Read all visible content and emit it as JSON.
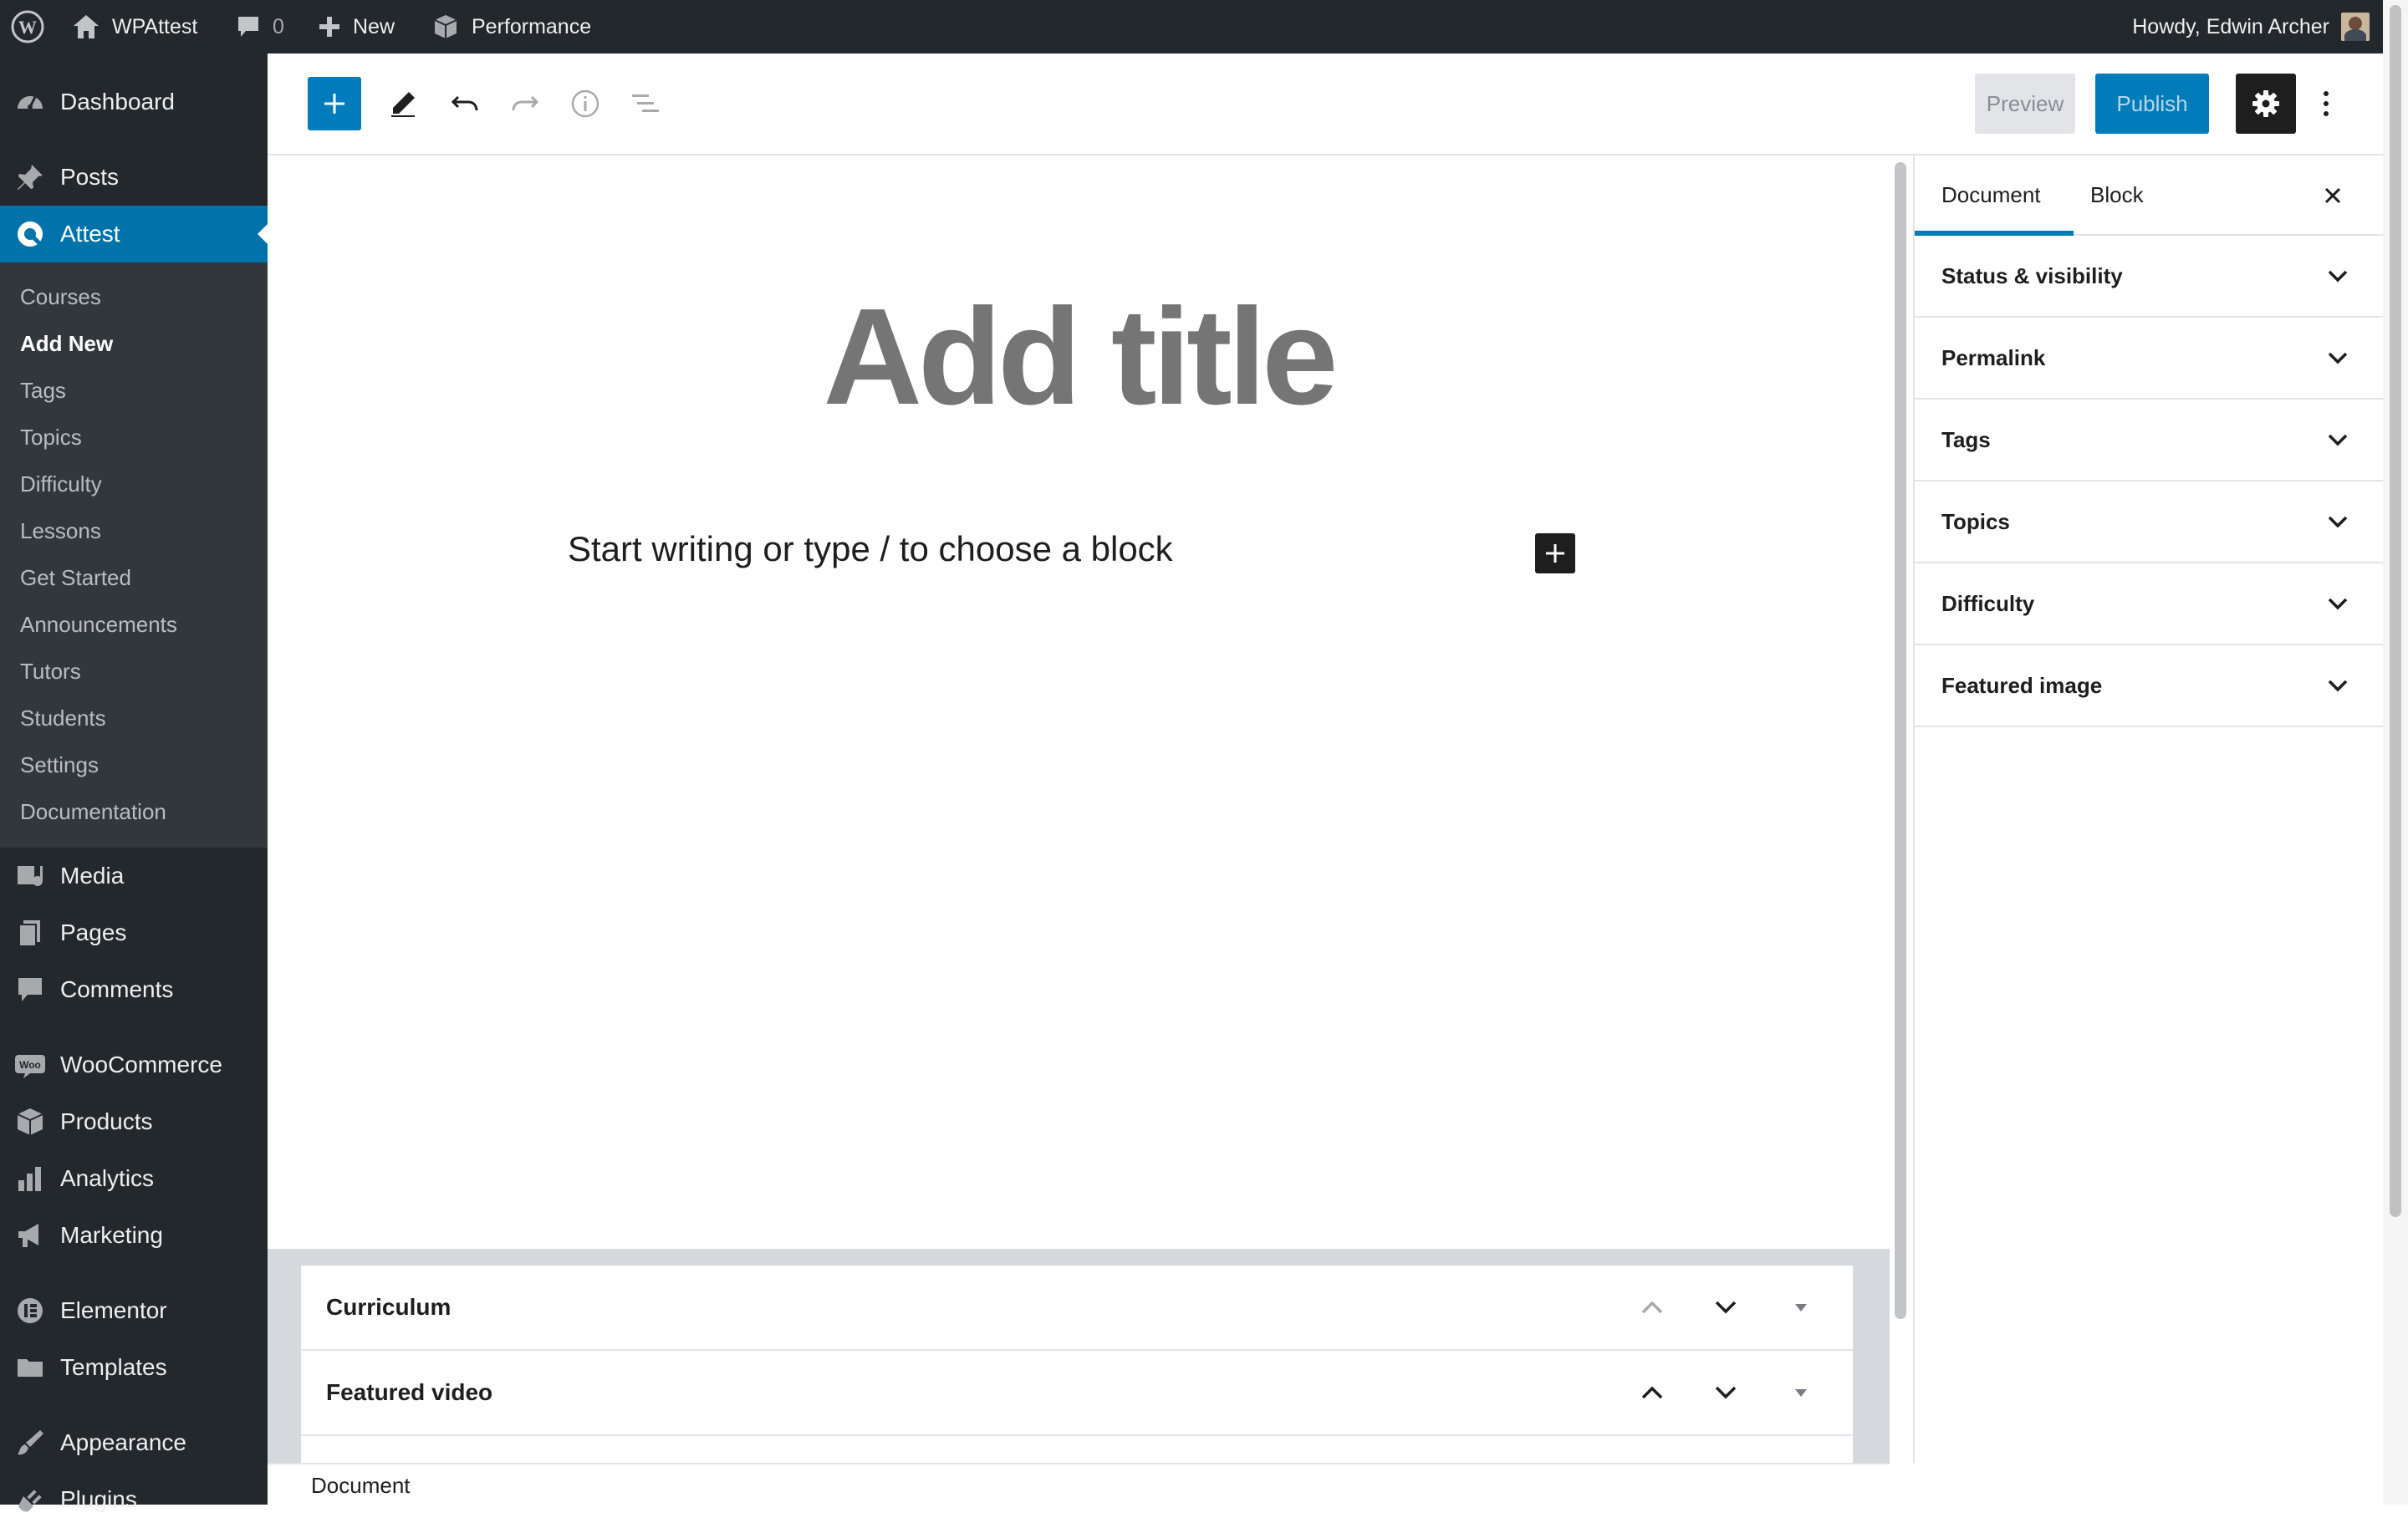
{
  "admin_bar": {
    "site_name": "WPAttest",
    "comments_count": "0",
    "new_label": "New",
    "performance_label": "Performance",
    "greeting": "Howdy, Edwin Archer"
  },
  "sidebar": {
    "top_items": [
      {
        "label": "Dashboard",
        "icon": "dashboard-icon"
      },
      {
        "label": "Posts",
        "icon": "pin-icon"
      },
      {
        "label": "Attest",
        "icon": "attest-icon"
      }
    ],
    "submenu": [
      "Courses",
      "Add New",
      "Tags",
      "Topics",
      "Difficulty",
      "Lessons",
      "Get Started",
      "Announcements",
      "Tutors",
      "Students",
      "Settings",
      "Documentation"
    ],
    "current_submenu": "Add New",
    "items": [
      {
        "label": "Media",
        "icon": "media-icon"
      },
      {
        "label": "Pages",
        "icon": "pages-icon"
      },
      {
        "label": "Comments",
        "icon": "comment-icon"
      },
      {
        "label": "WooCommerce",
        "icon": "woo-icon"
      },
      {
        "label": "Products",
        "icon": "box-icon"
      },
      {
        "label": "Analytics",
        "icon": "bar-chart-icon"
      },
      {
        "label": "Marketing",
        "icon": "megaphone-icon"
      },
      {
        "label": "Elementor",
        "icon": "elementor-icon"
      },
      {
        "label": "Templates",
        "icon": "folder-icon"
      },
      {
        "label": "Appearance",
        "icon": "brush-icon"
      },
      {
        "label": "Plugins",
        "icon": "plug-icon"
      }
    ]
  },
  "toolbar": {
    "preview_label": "Preview",
    "publish_label": "Publish"
  },
  "editor": {
    "title_placeholder": "Add title",
    "block_placeholder": "Start writing or type / to choose a block"
  },
  "meta_boxes": [
    {
      "title": "Curriculum"
    },
    {
      "title": "Featured video"
    }
  ],
  "status_bar": {
    "breadcrumb": "Document"
  },
  "inspector": {
    "tabs": [
      {
        "label": "Document"
      },
      {
        "label": "Block"
      }
    ],
    "active_tab": "Document",
    "panels": [
      "Status & visibility",
      "Permalink",
      "Tags",
      "Topics",
      "Difficulty",
      "Featured image"
    ]
  },
  "colors": {
    "admin_bar_bg": "#23282d",
    "sidebar_bg": "#23282d",
    "submenu_bg": "#32373c",
    "accent": "#0073aa",
    "publish_bg": "#007cba"
  }
}
